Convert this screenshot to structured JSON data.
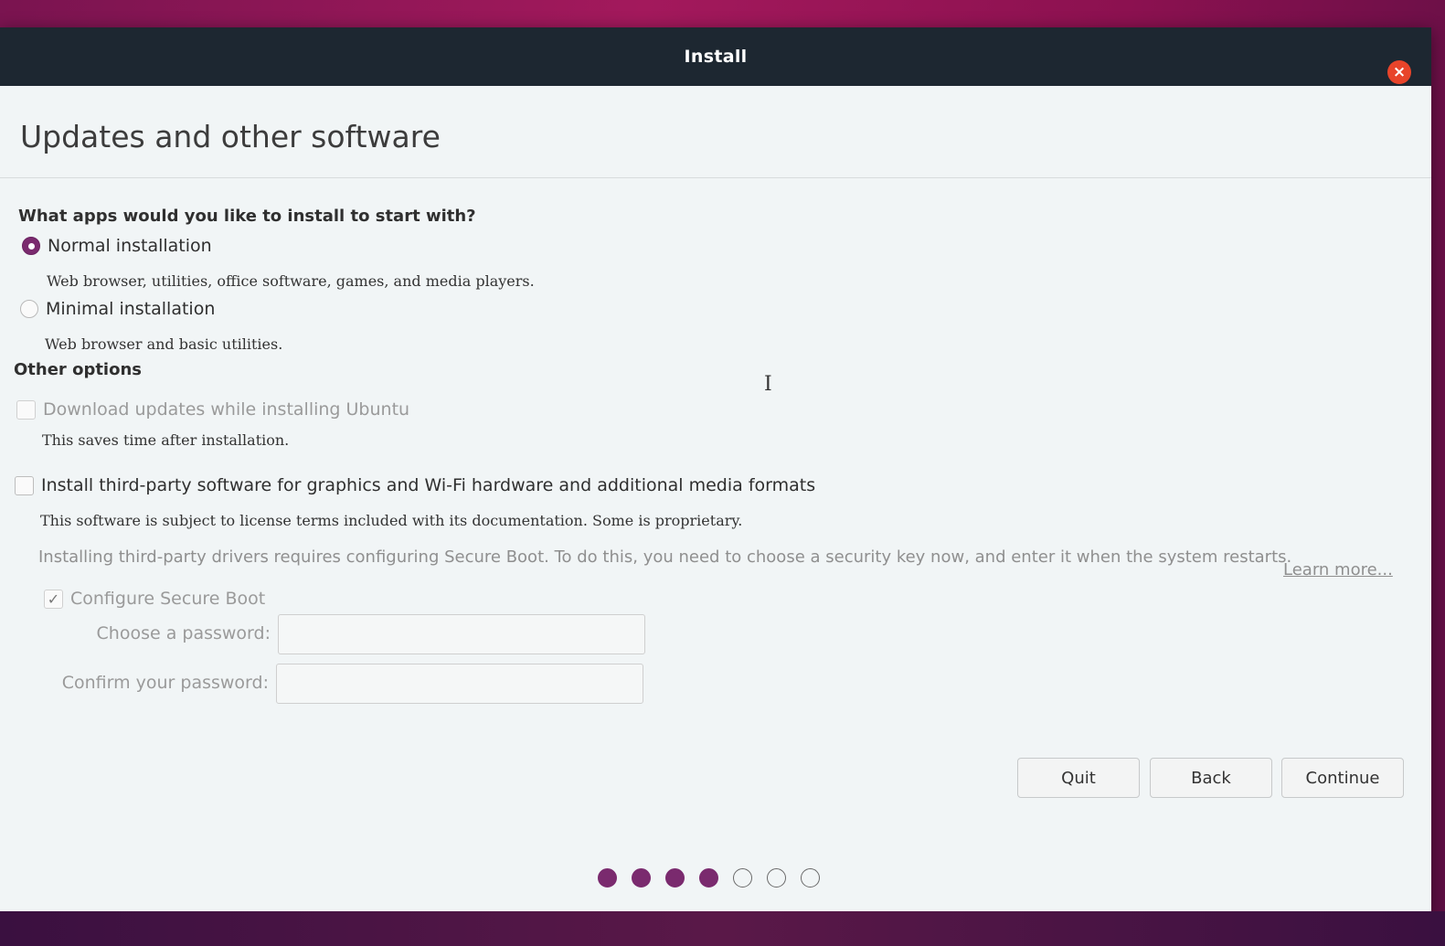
{
  "window": {
    "title": "Install",
    "close_icon": "×"
  },
  "page": {
    "title": "Updates and other software"
  },
  "apps_section": {
    "heading": "What apps would you like to install to start with?",
    "normal": {
      "label": "Normal installation",
      "description": "Web browser, utilities, office software, games, and media players.",
      "selected": true
    },
    "minimal": {
      "label": "Minimal installation",
      "description": "Web browser and basic utilities.",
      "selected": false
    }
  },
  "other_section": {
    "heading": "Other options",
    "download_updates": {
      "label": "Download updates while installing Ubuntu",
      "description": "This saves time after installation.",
      "checked": false,
      "enabled": false
    },
    "third_party": {
      "label": "Install third-party software for graphics and Wi-Fi hardware and additional media formats",
      "description": "This software is subject to license terms included with its documentation. Some is proprietary.",
      "checked": false
    },
    "secure_boot_info": "Installing third-party drivers requires configuring Secure Boot. To do this, you need to choose a security key now, and enter it when the system restarts.",
    "learn_more": "Learn more...",
    "configure_secure_boot": {
      "label": "Configure Secure Boot",
      "checked": true,
      "check_icon": "✓"
    },
    "password_label": "Choose a password:",
    "password_value": "",
    "confirm_label": "Confirm your password:",
    "confirm_value": ""
  },
  "buttons": {
    "quit": "Quit",
    "back": "Back",
    "continue": "Continue"
  },
  "progress": {
    "total_steps": 7,
    "completed_steps": 4
  },
  "cursor_glyph": "I"
}
